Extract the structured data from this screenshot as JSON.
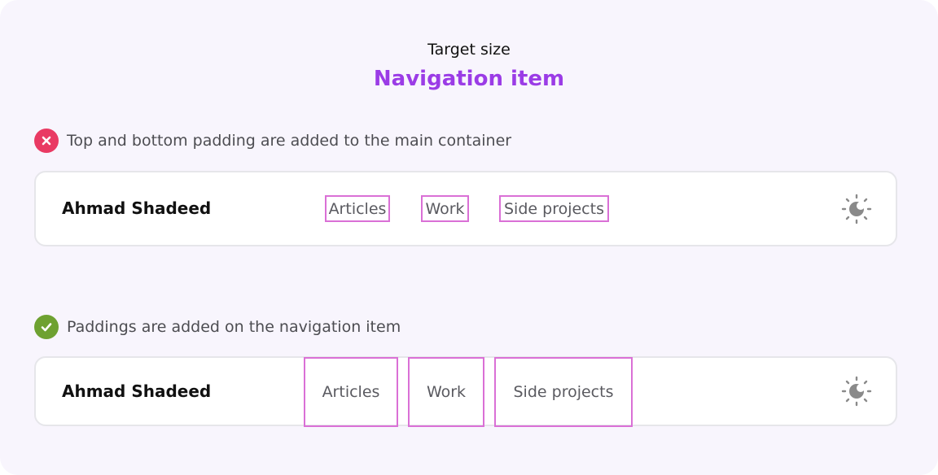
{
  "header": {
    "subtitle": "Target size",
    "title": "Navigation item"
  },
  "examples": [
    {
      "status": "incorrect",
      "status_icon": "x-icon",
      "caption": "Top and bottom padding are added to the main container",
      "brand": "Ahmad Shadeed",
      "nav_items": [
        "Articles",
        "Work",
        "Side projects"
      ],
      "theme_icon": "theme-toggle-icon"
    },
    {
      "status": "correct",
      "status_icon": "check-icon",
      "caption": "Paddings are added on the navigation item",
      "brand": "Ahmad Shadeed",
      "nav_items": [
        "Articles",
        "Work",
        "Side projects"
      ],
      "theme_icon": "theme-toggle-icon"
    }
  ],
  "colors": {
    "accent": "#9b3ce6",
    "incorrect": "#e93a63",
    "correct": "#6ea131",
    "highlight_outline": "#da70d6"
  }
}
